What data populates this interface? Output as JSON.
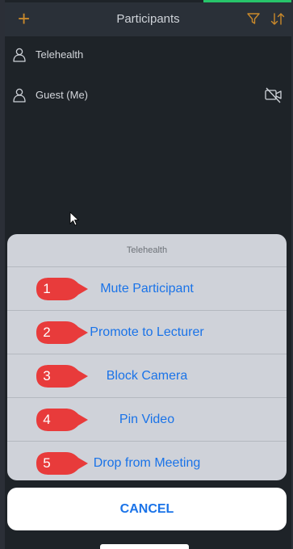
{
  "navbar": {
    "title": "Participants",
    "add_icon": "plus-icon",
    "filter_icon": "filter-icon",
    "sort_icon": "sort-icon",
    "accent_color": "#c9892b"
  },
  "participants": [
    {
      "name": "Telehealth",
      "icon": "person-icon",
      "camera_off": false
    },
    {
      "name": "Guest (Me)",
      "icon": "person-icon",
      "camera_off": true
    }
  ],
  "action_sheet": {
    "title": "Telehealth",
    "actions": [
      {
        "number": "1",
        "label": "Mute Participant"
      },
      {
        "number": "2",
        "label": "Promote to Lecturer"
      },
      {
        "number": "3",
        "label": "Block Camera"
      },
      {
        "number": "4",
        "label": "Pin Video"
      },
      {
        "number": "5",
        "label": "Drop from Meeting"
      }
    ],
    "cancel_label": "CANCEL",
    "action_color": "#1a73e8",
    "badge_color": "#e83b3b"
  }
}
